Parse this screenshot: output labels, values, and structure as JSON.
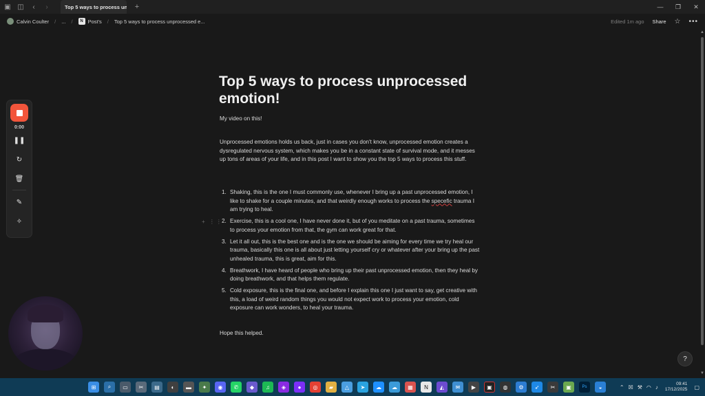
{
  "tab": {
    "title": "Top 5 ways to process unp..."
  },
  "breadcrumb": {
    "workspace": "Calvin Coulter",
    "ellipsis": "...",
    "parent": "Post's",
    "page": "Top 5 ways to process unprocessed e..."
  },
  "toolbar": {
    "edited": "Edited 1m ago",
    "share": "Share"
  },
  "page": {
    "title": "Top 5 ways to process unprocessed emotion!",
    "video_line": "My video on this!",
    "intro": "Unprocessed emotions holds us back, just in cases you don't know, unprocessed emotion creates a dysregulated nervous system, which makes you be in a constant state of survival mode, and it messes up tons of areas of your life, and in this post I want to show you the top 5 ways to process this stuff.",
    "list": [
      {
        "num": "1.",
        "before": "Shaking, this is the one I must commonly use, whenever I bring up a past unprocessed emotion, I like to shake for a couple minutes, and that weirdly enough works to process the ",
        "spell": "specefic",
        "after": " trauma I am trying to heal."
      },
      {
        "num": "2.",
        "text": "Exercise, this is a cool one, I have never done it, but of you meditate on a past trauma, sometimes to process your emotion from that, the gym can work great for that."
      },
      {
        "num": "3.",
        "text": "Let it all out, this is the best one and is the one we should be aiming for every time we try heal our trauma, basically this one is all about just letting yourself cry or whatever after your bring up the past unhealed trauma, this is great, aim for this."
      },
      {
        "num": "4.",
        "text": "Breathwork, I have heard of people who bring up their past unprocessed emotion, then they heal by doing breathwork, and that helps them regulate."
      },
      {
        "num": "5.",
        "text": "Cold exposure, this is the final one, and before I explain this one I just want to say, get creative with this, a load of weird random things you would not expect work to process your emotion, cold exposure can work wonders, to heal your trauma."
      }
    ],
    "outro": "Hope this helped."
  },
  "recorder": {
    "time": "0:00"
  },
  "taskbar": {
    "time": "09:41",
    "date": "17/12/2025"
  },
  "colors": {
    "record": "#f2553b",
    "taskbar": "#0f3b55",
    "background": "#191919"
  }
}
